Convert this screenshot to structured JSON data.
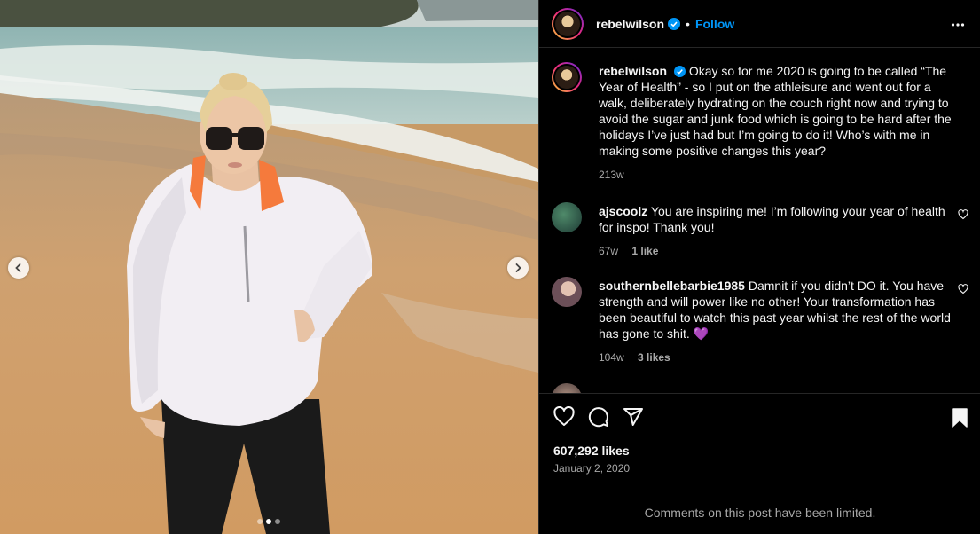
{
  "post": {
    "carousel": {
      "total": 3,
      "active_index": 1
    },
    "author": {
      "username": "rebelwilson",
      "verified": true,
      "follow_label": "Follow"
    },
    "caption": {
      "username": "rebelwilson",
      "text": "Okay so for me 2020 is going to be called “The Year of Health” - so I put on the athleisure and went out for a walk, deliberately hydrating on the couch right now and trying to avoid the sugar and junk food which is going to be hard after the holidays I’ve just had but I’m going to do it! Who’s with me in making some positive changes this year?",
      "age": "213w"
    },
    "comments": [
      {
        "username": "ajscoolz",
        "text": "You are inspiring me! I’m following your year of health for inspo! Thank you!",
        "age": "67w",
        "likes": "1 like"
      },
      {
        "username": "southernbellebarbie1985",
        "text": "Damnit if you didn’t DO it. You have strength and will power like no other! Your transformation has been beautiful to watch this past year whilst the rest of the world has gone to shit.",
        "emoji": "💜",
        "age": "104w",
        "likes": "3 likes"
      }
    ],
    "likes_text": "607,292 likes",
    "date": "January 2, 2020",
    "comments_limited": "Comments on this post have been limited."
  },
  "colors": {
    "accent": "#0095f6",
    "muted": "#a8a8a8",
    "background": "#000000"
  },
  "icons": [
    "verified-badge-icon",
    "more-icon",
    "heart-icon",
    "comment-icon",
    "share-icon",
    "bookmark-icon",
    "chevron-left-icon",
    "chevron-right-icon"
  ]
}
